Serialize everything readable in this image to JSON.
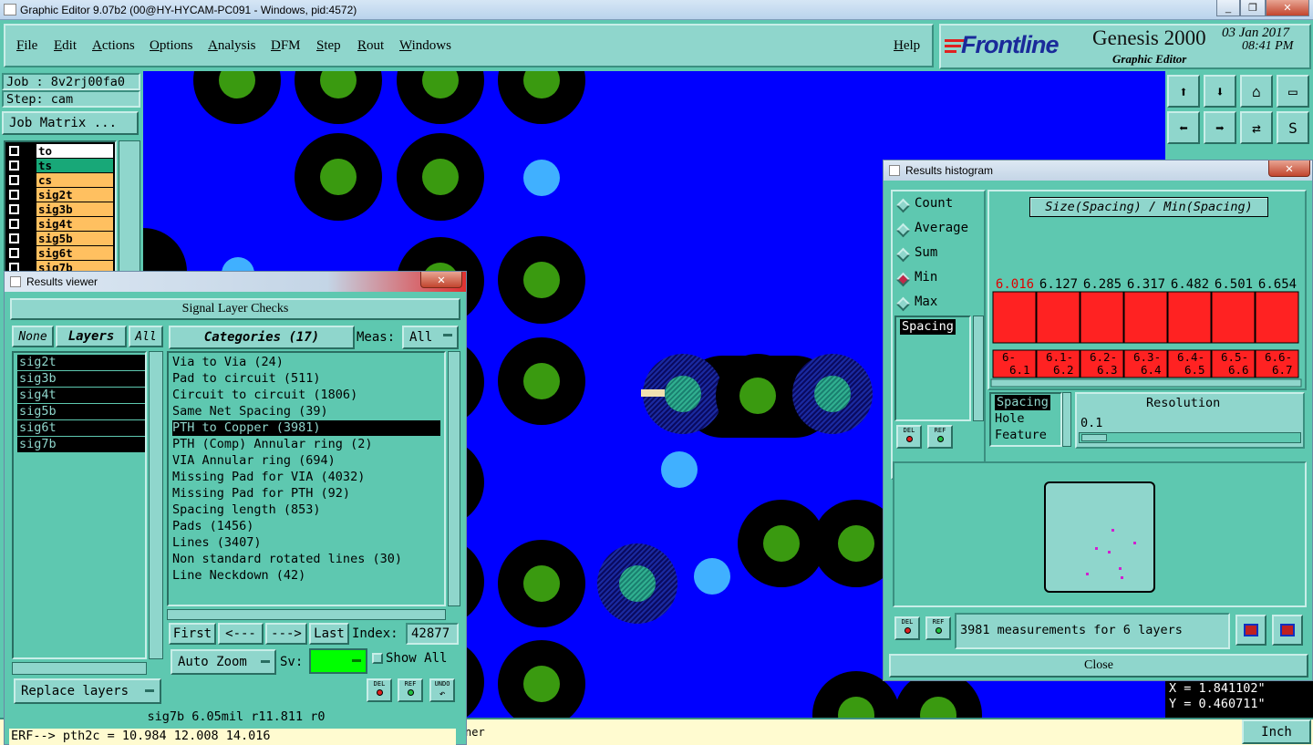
{
  "window": {
    "title": "Graphic Editor 9.07b2 (00@HY-HYCAM-PC091 - Windows, pid:4572)"
  },
  "menu": {
    "items": [
      "File",
      "Edit",
      "Actions",
      "Options",
      "Analysis",
      "DFM",
      "Step",
      "Rout",
      "Windows"
    ],
    "help": "Help"
  },
  "banner": {
    "brand": "Frontline",
    "product": "Genesis 2000",
    "subtitle": "Graphic Editor",
    "date": "03 Jan 2017",
    "time": "08:41 PM"
  },
  "job": {
    "job_label": "Job : 8v2rj00fa0",
    "step_label": "Step: cam",
    "matrix_button": "Job Matrix ..."
  },
  "layers": [
    {
      "name": "to",
      "color": "#ffffff"
    },
    {
      "name": "ts",
      "color": "#18a878"
    },
    {
      "name": "cs",
      "color": "#ffc060"
    },
    {
      "name": "sig2t",
      "color": "#ffc060"
    },
    {
      "name": "sig3b",
      "color": "#ffc060"
    },
    {
      "name": "sig4t",
      "color": "#ffc060"
    },
    {
      "name": "sig5b",
      "color": "#ffc060"
    },
    {
      "name": "sig6t",
      "color": "#ffc060"
    },
    {
      "name": "sig7b",
      "color": "#ffc060"
    }
  ],
  "results_viewer": {
    "title": "Results viewer",
    "header": "Signal Layer Checks",
    "none_btn": "None",
    "layers_btn": "Layers",
    "all_btn": "All",
    "layer_list": [
      "sig2t",
      "sig3b",
      "sig4t",
      "sig5b",
      "sig6t",
      "sig7b"
    ],
    "categories_btn": "Categories (17)",
    "meas_label": "Meas:",
    "meas_value": "All",
    "categories": [
      "Via to Via (24)",
      "Pad to circuit (511)",
      "Circuit to circuit (1806)",
      "Same Net Spacing (39)",
      "PTH to Copper (3981)",
      "PTH (Comp) Annular ring (2)",
      "VIA Annular ring (694)",
      "Missing Pad for VIA (4032)",
      "Missing Pad for PTH (92)",
      "Spacing length (853)",
      "Pads (1456)",
      "Lines (3407)",
      "Non standard rotated lines (30)",
      "Line Neckdown (42)"
    ],
    "selected_category": 4,
    "first_btn": "First",
    "prev_btn": "<---",
    "next_btn": "--->",
    "last_btn": "Last",
    "index_label": "Index:",
    "index_value": "42877",
    "auto_zoom": "Auto Zoom",
    "sv_label": "Sv:",
    "show_all": "Show All",
    "replace_layers": "Replace layers",
    "del": "DEL",
    "ref": "REF",
    "undo": "UNDO",
    "status": "sig7b  6.05mil  r11.811  r0"
  },
  "erf_line": "ERF--> pth2c = 10.984 12.008 14.016",
  "erf_tail": "ner",
  "histogram": {
    "title": "Results histogram",
    "modes": [
      "Count",
      "Average",
      "Sum",
      "Min",
      "Max"
    ],
    "selected_mode": "Min",
    "measure_list": [
      "Spacing"
    ],
    "chart_title": "Size(Spacing) / Min(Spacing)",
    "del": "DEL",
    "ref": "REF",
    "feature_list": [
      "Spacing",
      "Hole",
      "Feature"
    ],
    "resolution_label": "Resolution",
    "resolution_value": "0.1",
    "summary": "3981 measurements for 6 layers",
    "close": "Close"
  },
  "chart_data": {
    "type": "bar",
    "title": "Size(Spacing) / Min(Spacing)",
    "categories": [
      "6-\n 6.1",
      "6.1-\n 6.2",
      "6.2-\n 6.3",
      "6.3-\n 6.4",
      "6.4-\n 6.5",
      "6.5-\n 6.6",
      "6.6-\n 6.7"
    ],
    "values": [
      6.016,
      6.127,
      6.285,
      6.317,
      6.482,
      6.501,
      6.654
    ],
    "value_labels": [
      "6.016",
      "6.127",
      "6.285",
      "6.317",
      "6.482",
      "6.501",
      "6.654"
    ],
    "highlight_index": 0,
    "bar_color": "#ff2222"
  },
  "coords": {
    "x": "X = 1.841102\"",
    "y": "Y = 0.460711\""
  },
  "units": "Inch"
}
